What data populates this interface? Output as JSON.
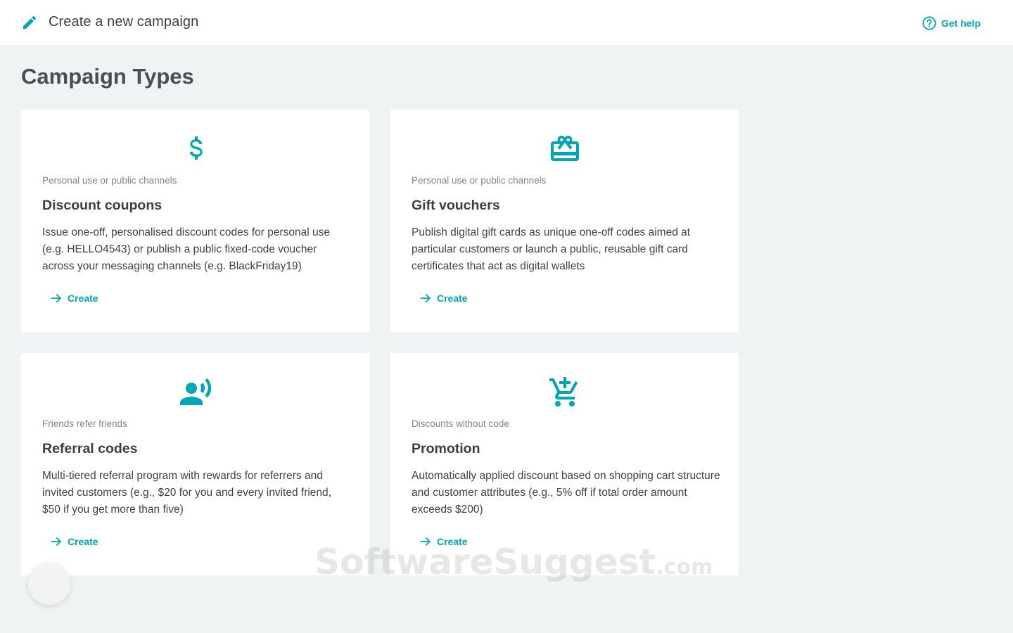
{
  "header": {
    "title": "Create a new campaign",
    "help_label": "Get help"
  },
  "page_title": "Campaign Types",
  "cards": [
    {
      "icon": "dollar-icon",
      "kicker": "Personal use or public channels",
      "title": "Discount coupons",
      "description": "Issue one-off, personalised discount codes for personal use (e.g. HELLO4543) or publish a public fixed-code voucher across your messaging channels (e.g. BlackFriday19)",
      "action": "Create"
    },
    {
      "icon": "gift-card-icon",
      "kicker": "Personal use or public channels",
      "title": "Gift vouchers",
      "description": "Publish digital gift cards as unique one-off codes aimed at particular customers or launch a public, reusable gift card certificates that act as digital wallets",
      "action": "Create"
    },
    {
      "icon": "record-voice-icon",
      "kicker": "Friends refer friends",
      "title": "Referral codes",
      "description": "Multi-tiered referral program with rewards for referrers and invited customers (e.g., $20 for you and every invited friend, $50 if you get more than five)",
      "action": "Create"
    },
    {
      "icon": "add-to-cart-icon",
      "kicker": "Discounts without code",
      "title": "Promotion",
      "description": "Automatically applied discount based on shopping cart structure and customer attributes (e.g., 5% off if total order amount exceeds $200)",
      "action": "Create"
    }
  ],
  "watermark": {
    "text": "SoftwareSuggest",
    "suffix": ".com"
  },
  "colors": {
    "accent": "#00a6b5",
    "background": "#eff3f4",
    "card": "#ffffff"
  }
}
